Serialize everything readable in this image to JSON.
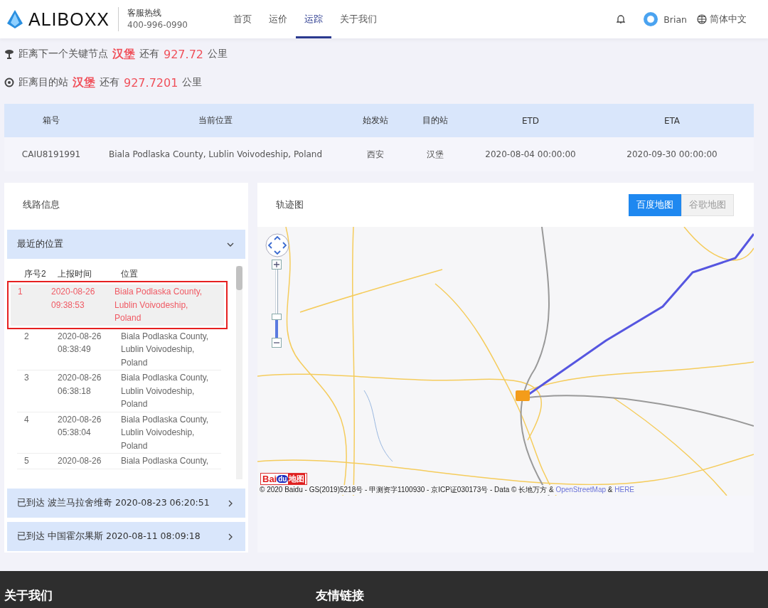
{
  "header": {
    "logo": "ALIBOXX",
    "hotline_label": "客服热线",
    "hotline_number": "400-996-0990",
    "nav": [
      {
        "label": "首页",
        "selected": false
      },
      {
        "label": "运价",
        "selected": false
      },
      {
        "label": "运踪",
        "selected": true
      },
      {
        "label": "关于我们",
        "selected": false
      }
    ],
    "user": "Brian",
    "language": "简体中文"
  },
  "distance_lines": [
    {
      "kind": "node",
      "prefix": "距离下一个关键节点",
      "place": "汉堡",
      "middle": "还有",
      "value": "927.72",
      "unit": "公里"
    },
    {
      "kind": "destination",
      "prefix": "距离目的站",
      "place": "汉堡",
      "middle": "还有",
      "value": "927.7201",
      "unit": "公里"
    }
  ],
  "shipment_table": {
    "columns": [
      "箱号",
      "当前位置",
      "始发站",
      "目的站",
      "ETD",
      "ETA"
    ],
    "rows": [
      [
        "CAIU8191991",
        "Biala Podlaska County, Lublin Voivodeship, Poland",
        "西安",
        "汉堡",
        "2020-08-04 00:00:00",
        "2020-09-30 00:00:00"
      ]
    ]
  },
  "route_panel": {
    "title": "线路信息",
    "sections": [
      {
        "label": "最近的位置",
        "expanded": true,
        "columns": [
          "序号2",
          "上报时间",
          "位置"
        ],
        "rows": [
          {
            "index": "1",
            "time": [
              "2020-08-26",
              "09:38:53"
            ],
            "location": [
              "Biala Podlaska County,",
              "Lublin Voivodeship,",
              "Poland"
            ],
            "selected": true
          },
          {
            "index": "2",
            "time": [
              "2020-08-26",
              "08:38:49"
            ],
            "location": [
              "Biala Podlaska County,",
              "Lublin Voivodeship,",
              "Poland"
            ],
            "selected": false
          },
          {
            "index": "3",
            "time": [
              "2020-08-26",
              "06:38:18"
            ],
            "location": [
              "Biala Podlaska County,",
              "Lublin Voivodeship,",
              "Poland"
            ],
            "selected": false
          },
          {
            "index": "4",
            "time": [
              "2020-08-26",
              "05:38:04"
            ],
            "location": [
              "Biala Podlaska County,",
              "Lublin Voivodeship,",
              "Poland"
            ],
            "selected": false
          },
          {
            "index": "5",
            "time": [
              "2020-08-26"
            ],
            "location": [
              "Biala Podlaska County,"
            ],
            "selected": false
          }
        ]
      },
      {
        "label": "已到达 波兰马拉舍维奇 2020-08-23 06:20:51",
        "expanded": false
      },
      {
        "label": "已到达 中国霍尔果斯 2020-08-11 08:09:18",
        "expanded": false
      }
    ]
  },
  "map_panel": {
    "title": "轨迹图",
    "map_types": [
      {
        "label": "百度地图",
        "selected": true
      },
      {
        "label": "谷歌地图",
        "selected": false
      }
    ],
    "zoom": {
      "level": 0.3
    },
    "logo": [
      "Bai",
      "du",
      "地图"
    ],
    "attribution": "© 2020 Baidu - GS(2019)5218号 - 甲测资字1100930 - 京ICP证030173号 - Data © 长地万方 &",
    "links": [
      "OpenStreetMap",
      "HERE"
    ],
    "link_separator": "&"
  },
  "footer": {
    "headings": [
      "关于我们",
      "友情链接"
    ]
  }
}
